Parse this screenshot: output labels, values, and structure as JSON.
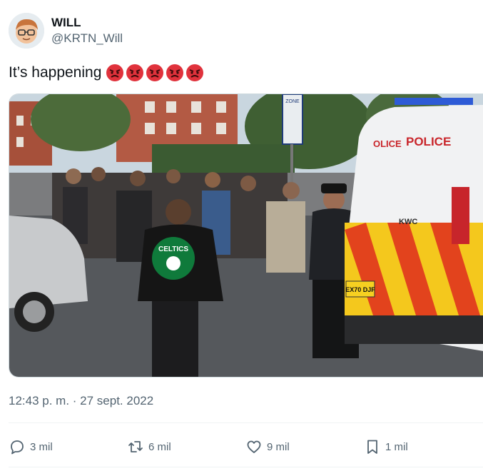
{
  "author": {
    "display_name": "WILL",
    "handle": "@KRTN_Will"
  },
  "tweet": {
    "text": "It’s happening",
    "emoji": [
      "angry-face",
      "angry-face",
      "angry-face",
      "angry-face",
      "angry-face"
    ]
  },
  "media": {
    "van_text_left": "OLICE",
    "van_text_right": "POLICE",
    "van_badge": "KWC",
    "plate": "EX70 DJF",
    "jacket_text": "CELTICS",
    "sign_top": "ZONE"
  },
  "timestamp": "12:43 p. m. · 27 sept. 2022",
  "actions": {
    "reply_count": "3 mil",
    "retweet_count": "6 mil",
    "like_count": "9 mil",
    "bookmark_count": "1 mil"
  },
  "colors": {
    "text": "#0f1419",
    "secondary": "#536471",
    "divider": "#eff3f4"
  }
}
